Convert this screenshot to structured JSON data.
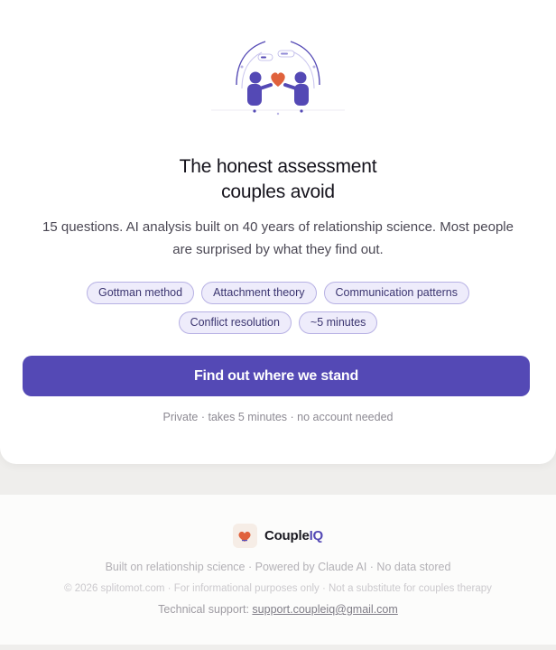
{
  "hero": {
    "title_line1": "The honest assessment",
    "title_line2": "couples avoid",
    "subtitle_line1": "15 questions. AI analysis built on 40 years of relationship science. Most people",
    "subtitle_line2": "are surprised by what they find out."
  },
  "tags": [
    "Gottman method",
    "Attachment theory",
    "Communication patterns",
    "Conflict resolution",
    "~5 minutes"
  ],
  "cta": {
    "label": "Find out where we stand"
  },
  "note": "Private · takes 5 minutes · no account needed",
  "footer": {
    "brand_prefix": "Couple",
    "brand_suffix": "IQ",
    "tagline": "Built on relationship science · Powered by Claude AI · No data stored",
    "copyright": "© 2026 splitomot.com · For informational purposes only · Not a substitute for couples therapy",
    "support_label": "Technical support:",
    "support_email": "support.coupleiq@gmail.com"
  },
  "colors": {
    "accent": "#5449b5",
    "heart": "#e0623c",
    "tag_bg": "#eeecfb",
    "tag_border": "#b7b1e4"
  },
  "icons": [
    "couple-heart-illustration",
    "coupleiq-logo-icon"
  ]
}
